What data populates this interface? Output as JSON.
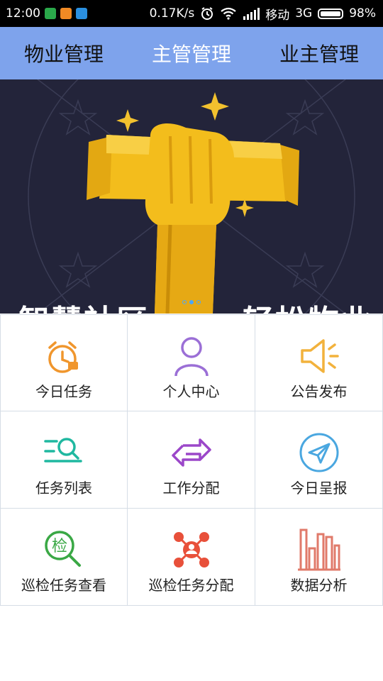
{
  "status_bar": {
    "time": "12:00",
    "speed": "0.17K/s",
    "carrier": "移动",
    "network": "3G",
    "battery": "98%"
  },
  "tabs": [
    {
      "label": "物业管理",
      "active": false
    },
    {
      "label": "主管管理",
      "active": true
    },
    {
      "label": "业主管理",
      "active": false
    }
  ],
  "banner": {
    "left_text": "智慧社区",
    "right_text": "轻松物业",
    "pages": 3,
    "current_page": 2
  },
  "grid": [
    {
      "label": "今日任务",
      "icon": "alarm-clock-icon",
      "color": "#f0962d"
    },
    {
      "label": "个人中心",
      "icon": "person-icon",
      "color": "#9b6fd6"
    },
    {
      "label": "公告发布",
      "icon": "megaphone-icon",
      "color": "#f2b23c"
    },
    {
      "label": "任务列表",
      "icon": "list-search-icon",
      "color": "#1fb8a0"
    },
    {
      "label": "工作分配",
      "icon": "swap-arrows-icon",
      "color": "#9b47c9"
    },
    {
      "label": "今日呈报",
      "icon": "paper-plane-icon",
      "color": "#4aa7e0"
    },
    {
      "label": "巡检任务查看",
      "icon": "inspect-magnifier-icon",
      "color": "#3aa845"
    },
    {
      "label": "巡检任务分配",
      "icon": "network-person-icon",
      "color": "#e8503a"
    },
    {
      "label": "数据分析",
      "icon": "bar-chart-icon",
      "color": "#e07a6a"
    }
  ],
  "grid_icon_glyph": {
    "inspect": "检"
  }
}
